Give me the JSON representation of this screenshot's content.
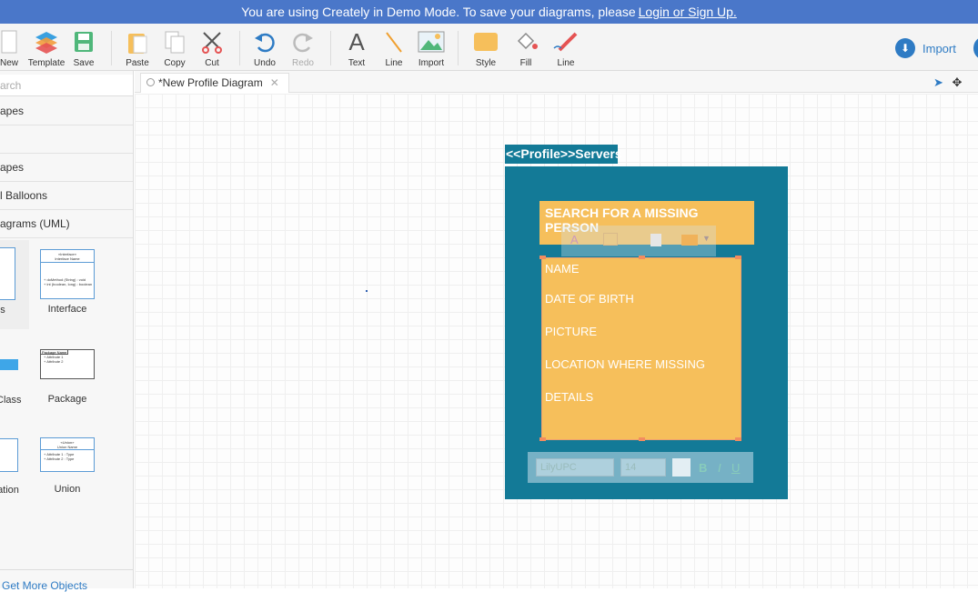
{
  "banner": {
    "text": "You are using Creately in Demo Mode. To save your diagrams, please",
    "link": "Login or Sign Up."
  },
  "toolbar": {
    "new": "New",
    "template": "Template",
    "save": "Save",
    "paste": "Paste",
    "copy": "Copy",
    "cut": "Cut",
    "undo": "Undo",
    "redo": "Redo",
    "text": "Text",
    "line": "Line",
    "import": "Import",
    "style": "Style",
    "fill": "Fill",
    "line2": "Line",
    "import_button": "Import"
  },
  "sidebar": {
    "search_placeholder": "arch",
    "categories": [
      "apes",
      "",
      "apes",
      "l Balloons",
      "agrams (UML)"
    ],
    "shapes": [
      "s",
      "Interface",
      "Class",
      "Package",
      "ation",
      "Union"
    ],
    "get_more": "Get More Objects"
  },
  "tab": {
    "title": "*New Profile Diagram"
  },
  "diagram": {
    "profile_label": "<<Profile>>Servers",
    "title": "SEARCH  FOR A MISSING PERSON",
    "attributes": [
      "NAME",
      "DATE OF BIRTH",
      "PICTURE",
      "LOCATION WHERE MISSING",
      "DETAILS"
    ],
    "font_name": "LilyUPC",
    "font_size": "14"
  },
  "colors": {
    "accent": "#4a77c9",
    "frame": "#137a97",
    "box": "#f6bf5b"
  }
}
